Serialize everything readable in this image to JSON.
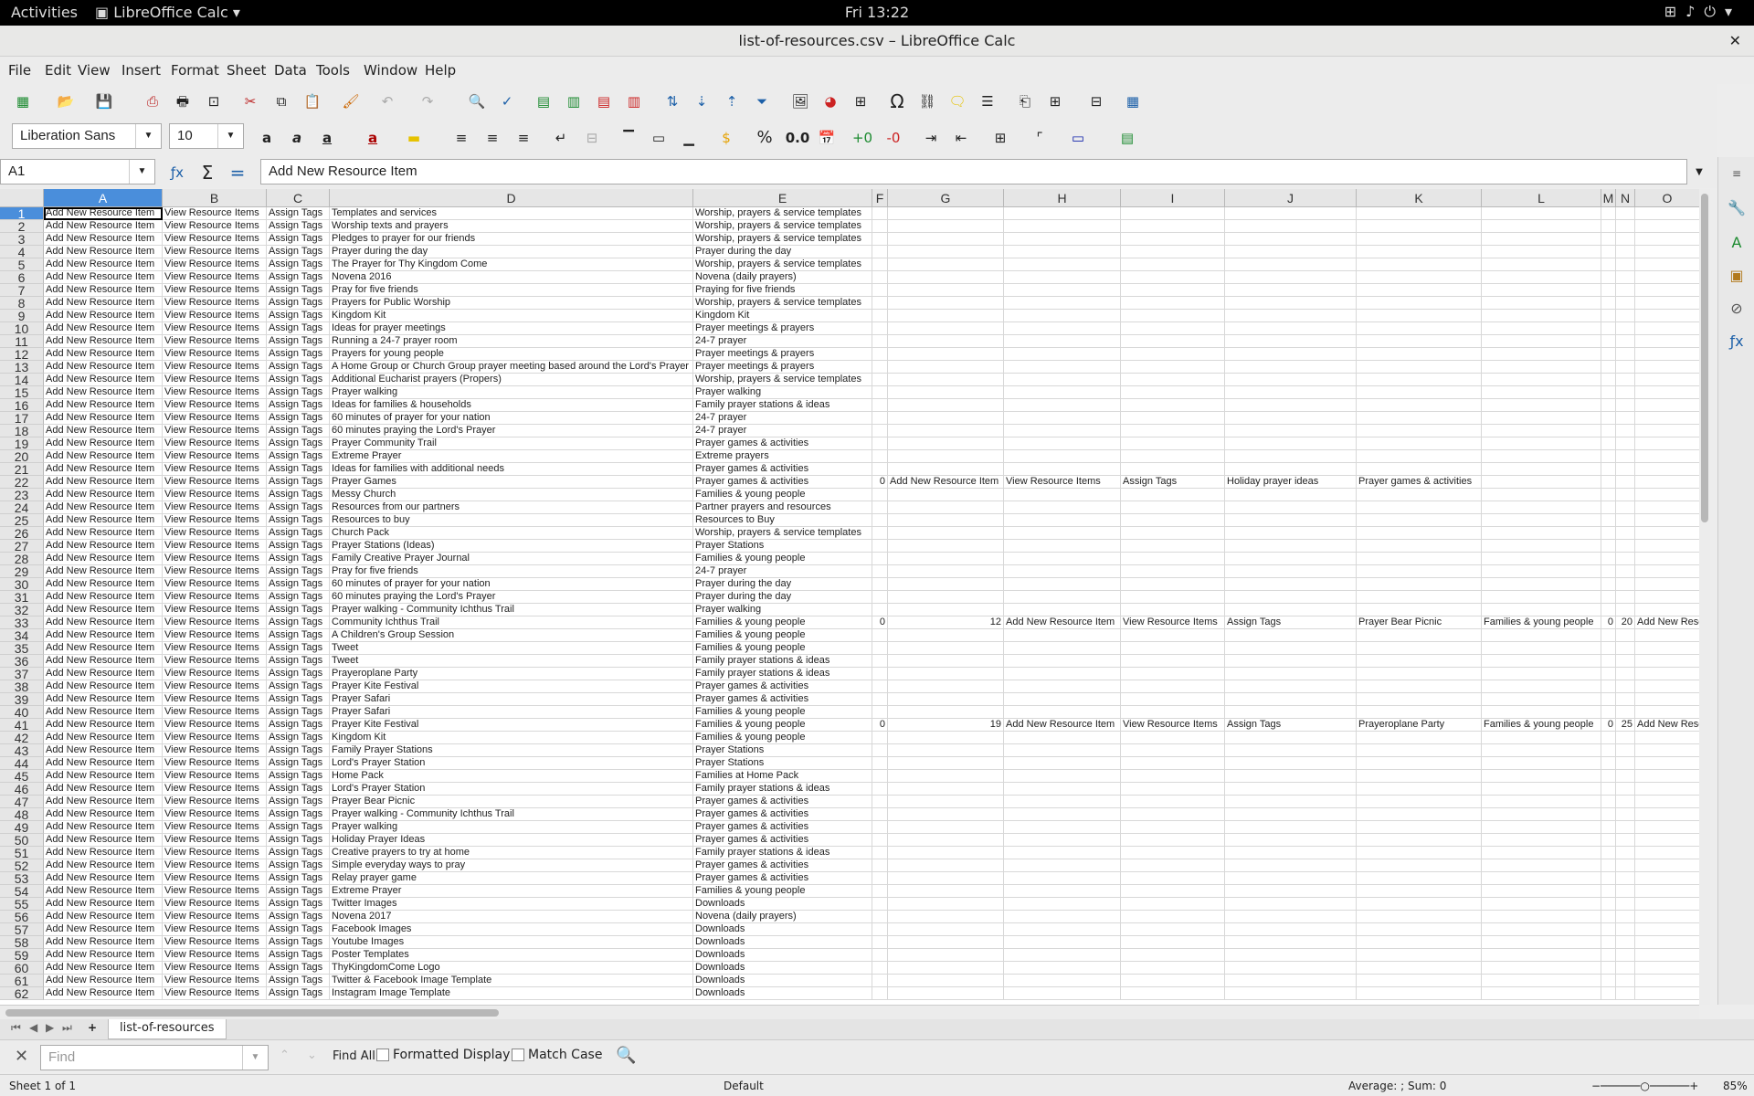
{
  "topbar": {
    "activities": "Activities",
    "app_menu": "LibreOffice Calc",
    "clock": "Fri 13:22"
  },
  "window": {
    "title": "list-of-resources.csv – LibreOffice Calc"
  },
  "menu": [
    "File",
    "Edit",
    "View",
    "Insert",
    "Format",
    "Sheet",
    "Data",
    "Tools",
    "Window",
    "Help"
  ],
  "format_toolbar": {
    "font_name": "Liberation Sans",
    "font_size": "10"
  },
  "formula_bar": {
    "name_box": "A1",
    "content": "Add New Resource Item"
  },
  "columns": [
    "A",
    "B",
    "C",
    "D",
    "E",
    "F",
    "G",
    "H",
    "I",
    "J",
    "K",
    "L",
    "M",
    "N",
    "O"
  ],
  "common": {
    "a": "Add New Resource Item",
    "b": "View Resource Items",
    "c": "Assign Tags"
  },
  "rows": [
    [
      "1",
      "Templates and services",
      "Worship, prayers & service templates"
    ],
    [
      "2",
      "Worship texts and prayers",
      "Worship, prayers & service templates"
    ],
    [
      "3",
      "Pledges to prayer for our friends",
      "Worship, prayers & service templates"
    ],
    [
      "4",
      "Prayer during the day",
      "Prayer during the day"
    ],
    [
      "5",
      "The Prayer for Thy Kingdom Come",
      "Worship, prayers & service templates"
    ],
    [
      "6",
      "Novena 2016",
      "Novena (daily prayers)"
    ],
    [
      "7",
      "Pray for five friends",
      "Praying for five friends"
    ],
    [
      "8",
      "Prayers for Public Worship",
      "Worship, prayers & service templates"
    ],
    [
      "9",
      "Kingdom Kit",
      "Kingdom Kit"
    ],
    [
      "10",
      "Ideas for prayer meetings",
      "Prayer meetings & prayers"
    ],
    [
      "11",
      "Running a 24-7 prayer room",
      "24-7 prayer"
    ],
    [
      "12",
      "Prayers for young people",
      "Prayer meetings & prayers"
    ],
    [
      "13",
      "A Home Group or Church Group prayer meeting based around the Lord's Prayer",
      "Prayer meetings & prayers"
    ],
    [
      "14",
      "Additional Eucharist prayers (Propers)",
      "Worship, prayers & service templates"
    ],
    [
      "15",
      "Prayer walking",
      "Prayer walking"
    ],
    [
      "16",
      "Ideas for families & households",
      "Family prayer stations & ideas"
    ],
    [
      "17",
      "60 minutes of prayer for your nation",
      "24-7 prayer"
    ],
    [
      "18",
      "60 minutes praying the Lord's Prayer",
      "24-7 prayer"
    ],
    [
      "19",
      "Prayer Community Trail",
      "Prayer games & activities"
    ],
    [
      "20",
      "Extreme Prayer",
      "Extreme prayers"
    ],
    [
      "21",
      "Ideas for families with additional needs",
      "Prayer games & activities"
    ],
    [
      "22",
      "Prayer Games",
      "Prayer games & activities"
    ],
    [
      "23",
      "Messy Church",
      "Families & young people"
    ],
    [
      "24",
      "Resources from our partners",
      "Partner prayers and resources"
    ],
    [
      "25",
      "Resources to buy",
      "Resources to Buy"
    ],
    [
      "26",
      "Church Pack",
      "Worship, prayers & service templates"
    ],
    [
      "27",
      "Prayer Stations (Ideas)",
      "Prayer Stations"
    ],
    [
      "28",
      "Family Creative Prayer Journal",
      "Families & young people"
    ],
    [
      "29",
      "Pray for five friends",
      "24-7 prayer"
    ],
    [
      "30",
      "60 minutes of prayer for your nation",
      "Prayer during the day"
    ],
    [
      "31",
      "60 minutes praying the Lord's Prayer",
      "Prayer during the day"
    ],
    [
      "32",
      "Prayer walking - Community Ichthus Trail",
      "Prayer walking"
    ],
    [
      "33",
      "Community Ichthus Trail",
      "Families & young people"
    ],
    [
      "34",
      "A Children's Group Session",
      "Families & young people"
    ],
    [
      "35",
      "Tweet",
      "Families & young people"
    ],
    [
      "36",
      "Tweet",
      "Family prayer stations & ideas"
    ],
    [
      "37",
      "Prayeroplane Party",
      "Family prayer stations & ideas"
    ],
    [
      "38",
      "Prayer Kite Festival",
      "Prayer games & activities"
    ],
    [
      "39",
      "Prayer Safari",
      "Prayer games & activities"
    ],
    [
      "40",
      "Prayer Safari",
      "Families & young people"
    ],
    [
      "41",
      "Prayer Kite Festival",
      "Families & young people"
    ],
    [
      "42",
      "Kingdom Kit",
      "Families & young people"
    ],
    [
      "43",
      "Family Prayer Stations",
      "Prayer Stations"
    ],
    [
      "44",
      "Lord's Prayer Station",
      "Prayer Stations"
    ],
    [
      "45",
      "Home Pack",
      "Families at Home Pack"
    ],
    [
      "46",
      "Lord's Prayer Station",
      "Family prayer stations & ideas"
    ],
    [
      "47",
      "Prayer Bear Picnic",
      "Prayer games & activities"
    ],
    [
      "48",
      "Prayer walking - Community Ichthus Trail",
      "Prayer games & activities"
    ],
    [
      "49",
      "Prayer walking",
      "Prayer games & activities"
    ],
    [
      "50",
      "Holiday Prayer Ideas",
      "Prayer games & activities"
    ],
    [
      "51",
      "Creative prayers to try at home",
      "Family prayer stations & ideas"
    ],
    [
      "52",
      "Simple everyday ways to pray",
      "Prayer games & activities"
    ],
    [
      "53",
      "Relay prayer game",
      "Prayer games & activities"
    ],
    [
      "54",
      "Extreme Prayer",
      "Families & young people"
    ],
    [
      "55",
      "Twitter Images",
      "Downloads"
    ],
    [
      "56",
      "Novena 2017",
      "Novena (daily prayers)"
    ],
    [
      "57",
      "Facebook Images",
      "Downloads"
    ],
    [
      "58",
      "Youtube Images",
      "Downloads"
    ],
    [
      "59",
      "Poster Templates",
      "Downloads"
    ],
    [
      "60",
      "ThyKingdomCome Logo",
      "Downloads"
    ],
    [
      "61",
      "Twitter & Facebook Image Template",
      "Downloads"
    ],
    [
      "62",
      "Instagram Image Template",
      "Downloads"
    ]
  ],
  "extra": {
    "r22": {
      "f": "0",
      "g": "Add New Resource Item",
      "h": "View Resource Items",
      "i": "Assign Tags",
      "j": "Holiday prayer ideas",
      "k": "Prayer games & activities"
    },
    "r33": {
      "f": "0",
      "g": "12",
      "h": "Add New Resource Item",
      "i": "View Resource Items",
      "j": "Assign Tags",
      "k": "Prayer Bear Picnic",
      "l": "Families & young people",
      "m": "0",
      "n": "20",
      "o": "Add New Reso"
    },
    "r41": {
      "f": "0",
      "g": "19",
      "h": "Add New Resource Item",
      "i": "View Resource Items",
      "j": "Assign Tags",
      "k": "Prayeroplane Party",
      "l": "Families & young people",
      "m": "0",
      "n": "25",
      "o": "Add New Reso"
    }
  },
  "sheet_tabs": [
    "list-of-resources"
  ],
  "findbar": {
    "placeholder": "Find",
    "find_all": "Find All",
    "formatted_display": "Formatted Display",
    "match_case": "Match Case"
  },
  "statusbar": {
    "sheet": "Sheet 1 of 1",
    "style": "Default",
    "summary": "Average: ; Sum: 0",
    "zoom": "85%"
  }
}
